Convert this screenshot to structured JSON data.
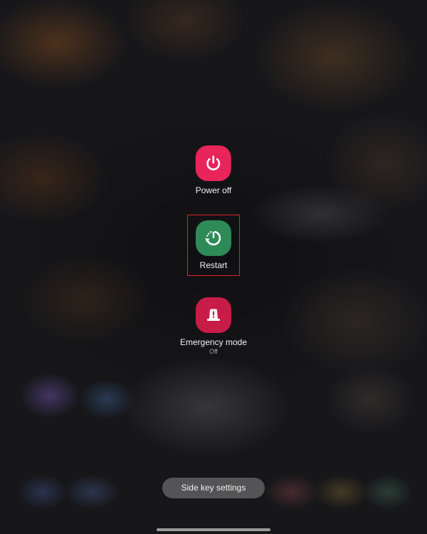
{
  "power_menu": {
    "power_off": {
      "label": "Power off",
      "icon": "power-icon",
      "color": "#e8245a"
    },
    "restart": {
      "label": "Restart",
      "icon": "restart-icon",
      "color": "#2e8a56",
      "highlight_color": "#e02020"
    },
    "emergency": {
      "label": "Emergency mode",
      "status": "Off",
      "icon": "emergency-siren-icon",
      "color": "#c81c48"
    }
  },
  "footer": {
    "side_key_label": "Side key settings"
  }
}
